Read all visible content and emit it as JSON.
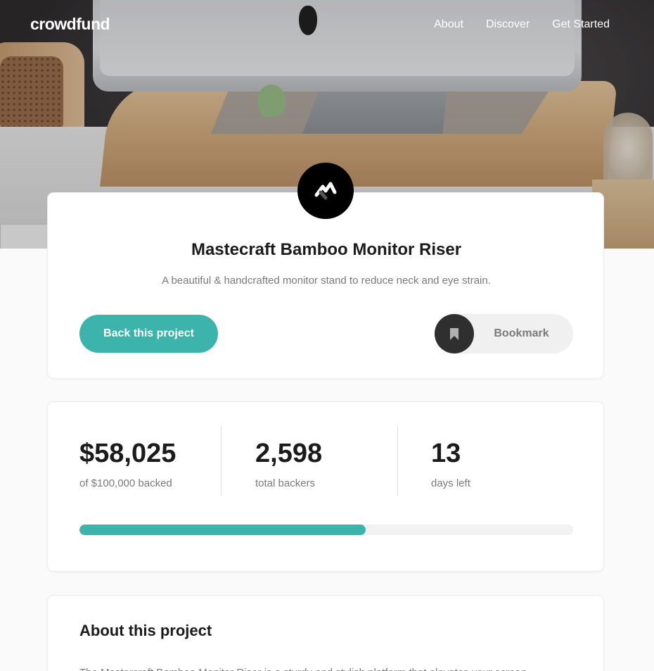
{
  "nav": {
    "logo": "crowdfund",
    "links": [
      "About",
      "Discover",
      "Get Started"
    ]
  },
  "project": {
    "title": "Mastecraft Bamboo Monitor Riser",
    "subtitle": "A beautiful & handcrafted monitor stand to reduce neck and eye strain.",
    "back_label": "Back this project",
    "bookmark_label": "Bookmark"
  },
  "stats": {
    "backed_amount": "$58,025",
    "backed_label": "of $100,000 backed",
    "backers_count": "2,598",
    "backers_label": "total backers",
    "days_count": "13",
    "days_label": "days left",
    "progress_fraction": 0.58025
  },
  "about": {
    "title": "About this project",
    "text": "The Mastercraft Bamboo Monitor Riser is a sturdy and stylish platform that elevates your screen"
  },
  "colors": {
    "accent": "#3cb3ab",
    "dark": "#2f2f2f",
    "text_muted": "#7a7a7a"
  }
}
